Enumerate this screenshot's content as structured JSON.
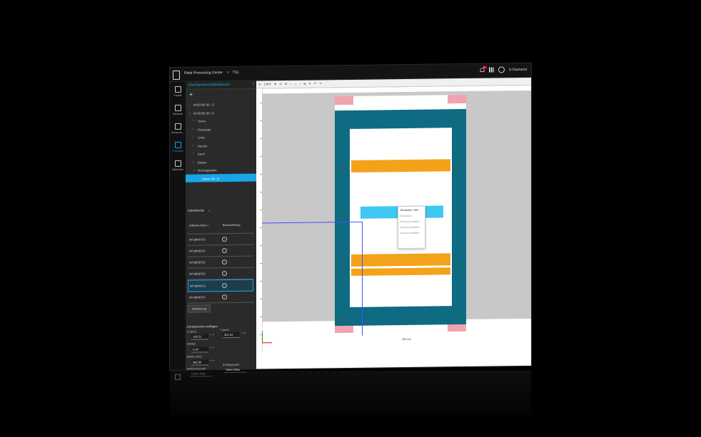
{
  "header": {
    "app_name": "Rittal Processing Center",
    "separator": ">",
    "project": "TS1",
    "notification_count": "9+",
    "user": "G.Raimond"
  },
  "rail": {
    "items": [
      {
        "label": "Projekt"
      },
      {
        "label": "Gehäuse"
      },
      {
        "label": "Kompone..."
      },
      {
        "label": "Processin"
      },
      {
        "label": "Bibliothek"
      }
    ]
  },
  "panel": {
    "title": "Oberflächenmodifikationen",
    "add_label": "+",
    "close_label": "‹",
    "tree": [
      {
        "label": "9002008 (ID: 1)",
        "level": 0,
        "chev": "›"
      },
      {
        "label": "9076008 (ID: 2)",
        "level": 0,
        "chev": "⌄"
      },
      {
        "label": "Vorne",
        "level": 1,
        "chev": "›"
      },
      {
        "label": "Rückseite",
        "level": 1,
        "chev": "›"
      },
      {
        "label": "Links",
        "level": 1,
        "chev": "›"
      },
      {
        "label": "Rechts",
        "level": 1,
        "chev": "›"
      },
      {
        "label": "Dach",
        "level": 1,
        "chev": "›"
      },
      {
        "label": "Boden",
        "level": 1,
        "chev": "›"
      },
      {
        "label": "Montageplatte",
        "level": 1,
        "chev": "⌄"
      },
      {
        "label": "Unten (ID: 3)",
        "level": 2,
        "chev": "",
        "selected": true
      }
    ],
    "dropdown": "Kabelkanäle",
    "table": {
      "headers": [
        "Artikelnumme r",
        "Beschreibung"
      ],
      "rows": [
        {
          "article": "WT.8808755",
          "selected": false
        },
        {
          "article": "WT.8808754",
          "selected": false
        },
        {
          "article": "WT.8808753",
          "selected": false
        },
        {
          "article": "WT.8808752",
          "selected": false
        },
        {
          "article": "WT.8808751",
          "selected": true
        },
        {
          "article": "WT.8808750",
          "selected": false
        }
      ]
    },
    "place_button": "Platzierung",
    "form": {
      "section": "Komponente einfügen",
      "x_label": "X [mm]",
      "x_value": "106.51",
      "y_label": "Y [mm]",
      "y_value": "351.24",
      "angle_label": "Winkel",
      "angle_value": "0.00",
      "width_label": "Breite [mm]",
      "width_value": "362.90",
      "ref_label": "Referenzpunkt",
      "ref_value": "Unten links",
      "insert_label": "Einfügepunkt",
      "insert_value": "Unten links"
    }
  },
  "toolbar": {
    "zoom": "135%"
  },
  "canvas": {
    "context_menu": {
      "title": "Einrasten: Bei",
      "options": [
        "Bohrungen",
        "Bohrung einstellen",
        "Bohrung einstellen",
        "Bohrung einstellen"
      ]
    },
    "ruler_label": "300 mm"
  },
  "colors": {
    "accent": "#1aa5e8",
    "teal": "#0e6b82",
    "orange": "#f4a21a",
    "cyan": "#3ec8f2",
    "pink": "#f2a3b0"
  }
}
